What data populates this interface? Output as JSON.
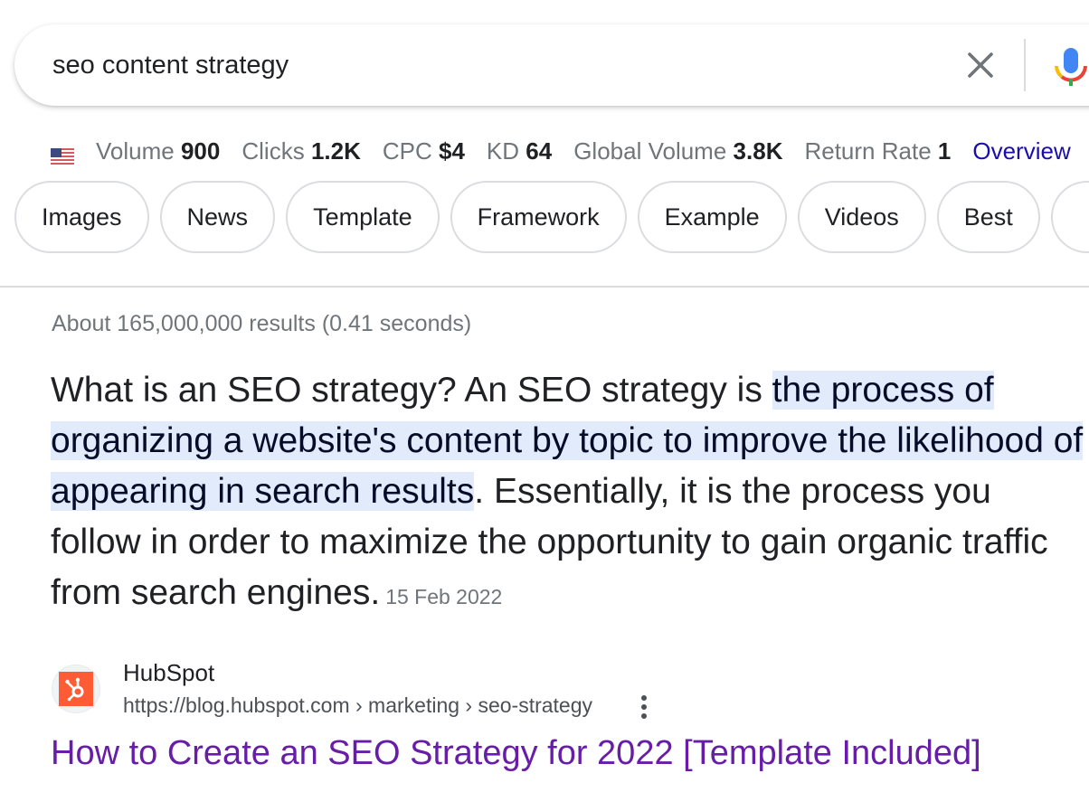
{
  "search": {
    "query": "seo content strategy",
    "clear_icon": "close-icon",
    "voice_icon": "google-mic-icon"
  },
  "metrics": {
    "flag_icon": "us-flag-icon",
    "items": [
      {
        "label": "Volume",
        "value": "900"
      },
      {
        "label": "Clicks",
        "value": "1.2K"
      },
      {
        "label": "CPC",
        "value": "$4"
      },
      {
        "label": "KD",
        "value": "64"
      },
      {
        "label": "Global Volume",
        "value": "3.8K"
      },
      {
        "label": "Return Rate",
        "value": "1"
      }
    ],
    "link_label": "Overview",
    "link_color": "#1a0dab"
  },
  "chips": [
    {
      "label": "Images"
    },
    {
      "label": "News"
    },
    {
      "label": "Template"
    },
    {
      "label": "Framework"
    },
    {
      "label": "Example"
    },
    {
      "label": "Videos"
    },
    {
      "label": "Best"
    },
    {
      "label": ""
    }
  ],
  "results_stats": "About 165,000,000 results (0.41 seconds)",
  "featured_snippet": {
    "before": "What is an SEO strategy? An SEO strategy is ",
    "highlight": "the process of organizing a website's content by topic to improve the likelihood of appearing in search results",
    "after": ". Essentially, it is the process you follow in order to maximize the opportunity to gain organic traffic from search engines.",
    "date": "15 Feb 2022",
    "highlight_color": "#e1ebfb"
  },
  "result": {
    "favicon": "hubspot-logo-icon",
    "brand_color": "#ff5c35",
    "site_name": "HubSpot",
    "url": "https://blog.hubspot.com › marketing › seo-strategy",
    "more_icon": "more-vert-icon",
    "title": "How to Create an SEO Strategy for 2022 [Template Included]",
    "title_color": "#681da8"
  }
}
